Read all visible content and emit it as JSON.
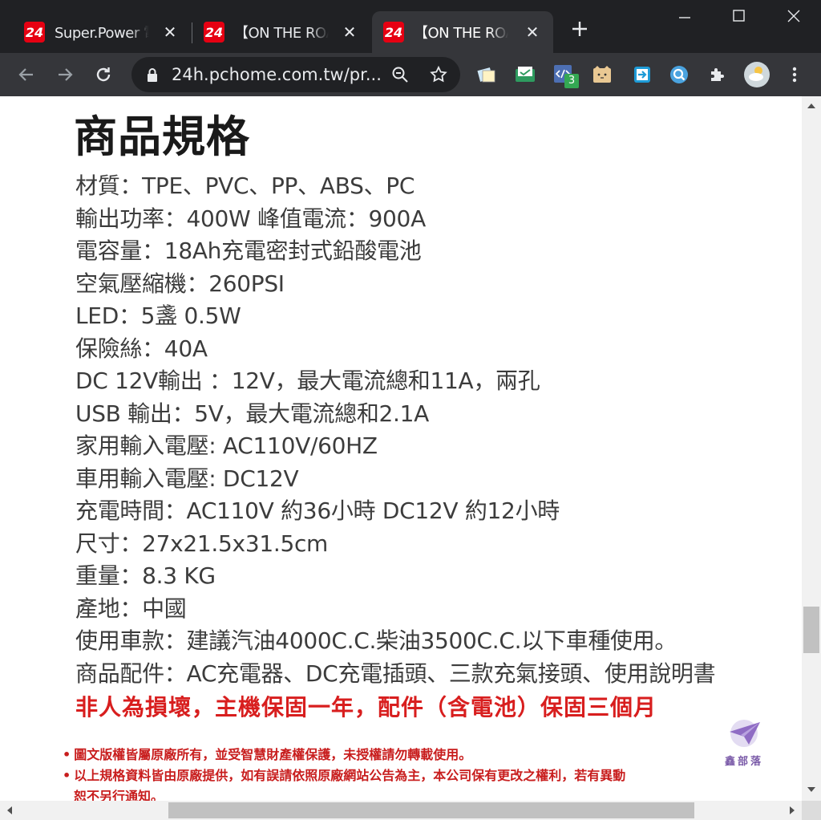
{
  "tabs": [
    {
      "favicon": "24",
      "title": "Super.Power 電",
      "close": "✕"
    },
    {
      "favicon": "24",
      "title": "【ON THE ROA",
      "close": "✕"
    },
    {
      "favicon": "24",
      "title": "【ON THE ROA",
      "close": "✕"
    }
  ],
  "address_bar": {
    "url": "24h.pchome.com.tw/pr..."
  },
  "extensions": {
    "badge_count": "3"
  },
  "page": {
    "heading": "商品規格",
    "specs": [
      "材質：TPE、PVC、PP、ABS、PC",
      "輸出功率：400W  峰值電流：900A",
      "電容量：18Ah充電密封式鉛酸電池",
      "空氣壓縮機：260PSI",
      "LED：5盞 0.5W",
      "保險絲：40A",
      "DC 12V輸出 ：12V，最大電流總和11A，兩孔",
      "USB   輸出：5V，最大電流總和2.1A",
      "家用輸入電壓: AC110V/60HZ",
      "車用輸入電壓: DC12V",
      "充電時間：AC110V 約36小時 DC12V 約12小時",
      "尺寸：27x21.5x31.5cm",
      "重量：8.3 KG",
      "產地：中國",
      "使用車款：建議汽油4000C.C.柴油3500C.C.以下車種使用。",
      "商品配件：AC充電器、DC充電插頭、三款充氣接頭、使用說明書"
    ],
    "warranty": "非人為損壞，主機保固一年，配件（含電池）保固三個月",
    "notices": [
      "圖文版權皆屬原廠所有，並受智慧財產權保護，未授權請勿轉載使用。",
      "以上規格資料皆由原廠提供，如有誤請依照原廠網站公告為主，本公司保有更改之權利，若有異動",
      "恕不另行通知。"
    ],
    "watermark": "鑫部落"
  },
  "colors": {
    "titlebar": "#202124",
    "toolbar": "#35363a",
    "warranty_red": "#d81e1e",
    "favicon_red": "#e60012"
  }
}
